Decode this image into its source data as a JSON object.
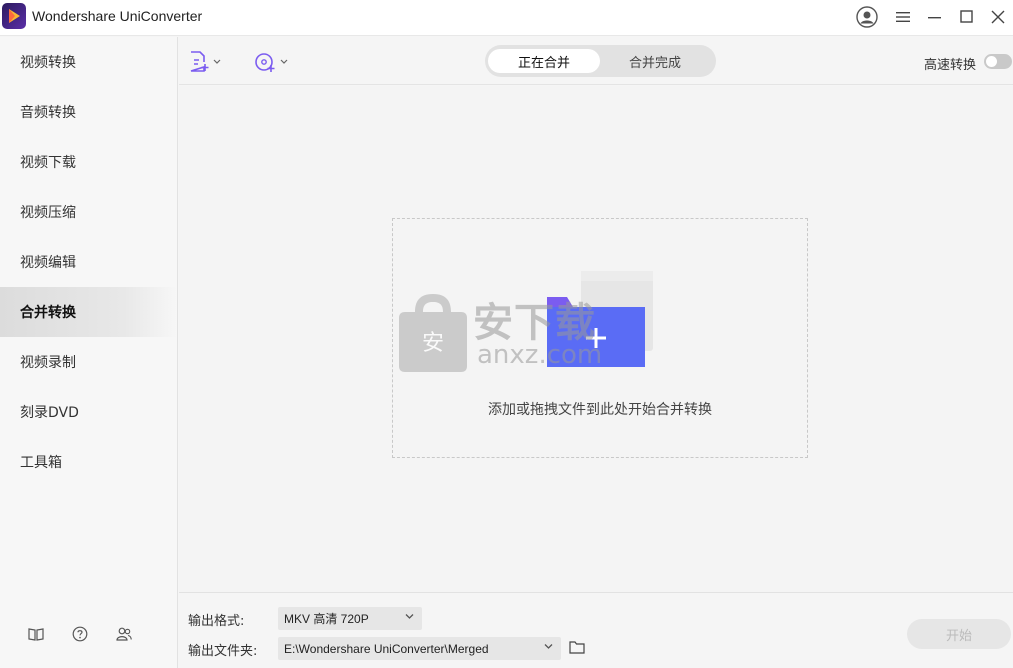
{
  "app": {
    "title": "Wondershare UniConverter"
  },
  "sidebar": {
    "items": [
      {
        "label": "视频转换"
      },
      {
        "label": "音频转换"
      },
      {
        "label": "视频下载"
      },
      {
        "label": "视频压缩"
      },
      {
        "label": "视频编辑"
      },
      {
        "label": "合并转换",
        "active": true
      },
      {
        "label": "视频录制"
      },
      {
        "label": "刻录DVD"
      },
      {
        "label": "工具箱"
      }
    ],
    "footer_icons": [
      "book-icon",
      "help-icon",
      "users-icon"
    ]
  },
  "toolbar": {
    "tabs": [
      {
        "label": "正在合并",
        "active": true
      },
      {
        "label": "合并完成"
      }
    ],
    "turbo_label": "高速转换",
    "turbo_enabled": false
  },
  "dropzone": {
    "hint": "添加或拖拽文件到此处开始合并转换"
  },
  "watermark": {
    "text": "安下载",
    "subtext": "anxz.com"
  },
  "footer": {
    "format_label": "输出格式:",
    "format_value": "MKV 高清 720P",
    "folder_label": "输出文件夹:",
    "folder_value": "E:\\Wondershare UniConverter\\Merged",
    "start_label": "开始"
  },
  "colors": {
    "accent": "#7b5cf0",
    "accent_blue": "#5a6cf5"
  }
}
